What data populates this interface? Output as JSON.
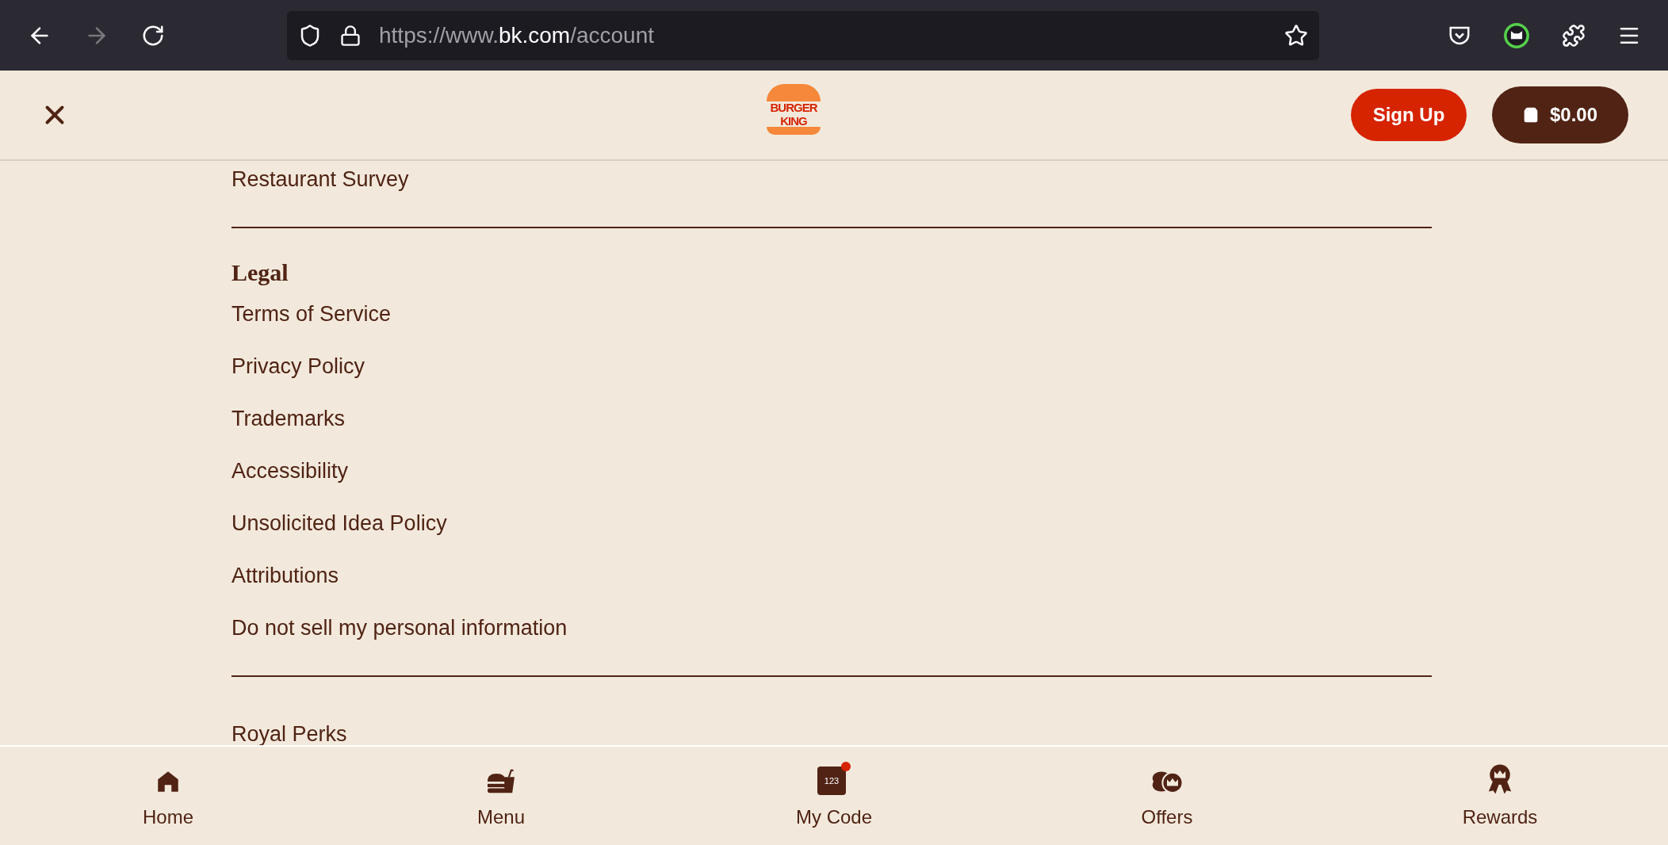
{
  "browser": {
    "url_parts": [
      {
        "text": "https://www.",
        "kind": "dim"
      },
      {
        "text": "bk.com",
        "kind": "host"
      },
      {
        "text": "/account",
        "kind": "dim"
      }
    ]
  },
  "header": {
    "logo_lines": [
      "BURGER",
      "KING"
    ],
    "sign_up": "Sign Up",
    "cart": "$0.00"
  },
  "menu": {
    "top_link": "Restaurant Survey",
    "legal": {
      "title": "Legal",
      "links": [
        "Terms of Service",
        "Privacy Policy",
        "Trademarks",
        "Accessibility",
        "Unsolicited Idea Policy",
        "Attributions",
        "Do not sell my personal information"
      ]
    },
    "bottom_link": "Royal Perks"
  },
  "nav": [
    {
      "label": "Home",
      "kind": "home"
    },
    {
      "label": "Menu",
      "kind": "menu"
    },
    {
      "label": "My Code",
      "kind": "code",
      "icon_text": "123"
    },
    {
      "label": "Offers",
      "kind": "offers"
    },
    {
      "label": "Rewards",
      "kind": "rewards"
    }
  ]
}
